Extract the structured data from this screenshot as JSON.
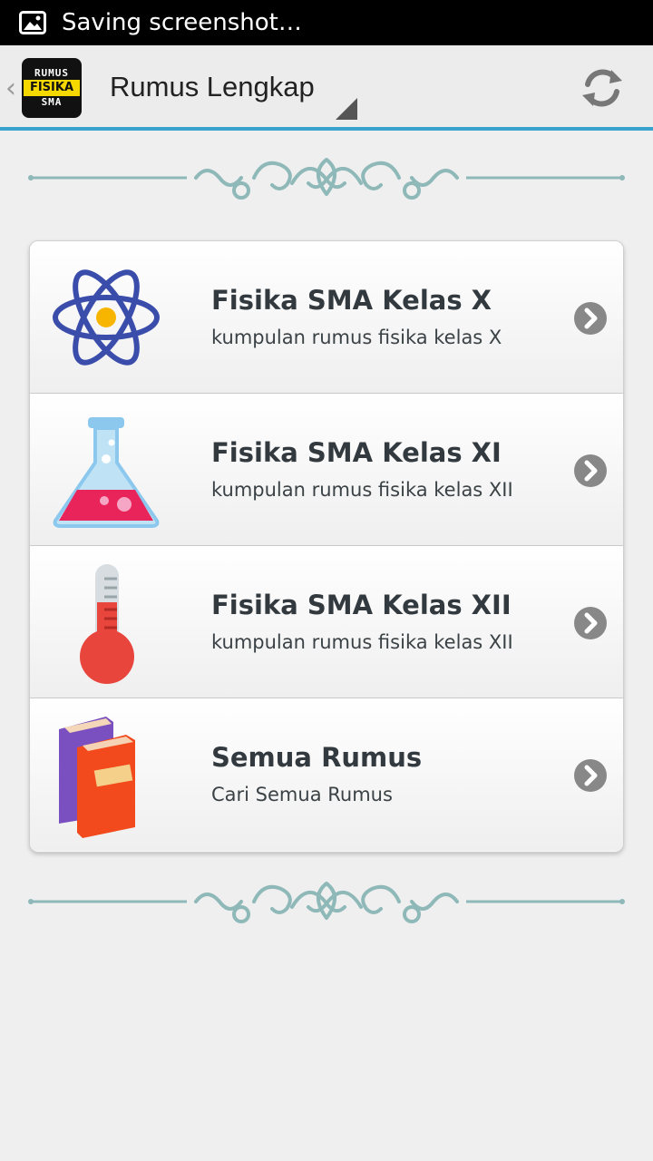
{
  "status_bar": {
    "text": "Saving screenshot…",
    "icon": "image-icon"
  },
  "action_bar": {
    "up_glyph": "‹",
    "logo_top": "RUMUS",
    "logo_mid": "FISIKA",
    "logo_bottom": "SMA",
    "title": "Rumus Lengkap",
    "refresh_icon": "refresh-icon"
  },
  "menu": [
    {
      "title": "Fisika SMA Kelas X",
      "subtitle": "kumpulan rumus fisika kelas X",
      "icon": "atom-icon"
    },
    {
      "title": "Fisika SMA Kelas XI",
      "subtitle": "kumpulan rumus fisika kelas XII",
      "icon": "flask-icon"
    },
    {
      "title": "Fisika SMA Kelas XII",
      "subtitle": "kumpulan rumus fisika kelas XII",
      "icon": "thermometer-icon"
    },
    {
      "title": "Semua Rumus",
      "subtitle": "Cari Semua Rumus",
      "icon": "books-icon"
    }
  ],
  "colors": {
    "accent": "#38a4cd",
    "ornament": "#8fb8b8",
    "logo_yellow": "#f5d800"
  }
}
